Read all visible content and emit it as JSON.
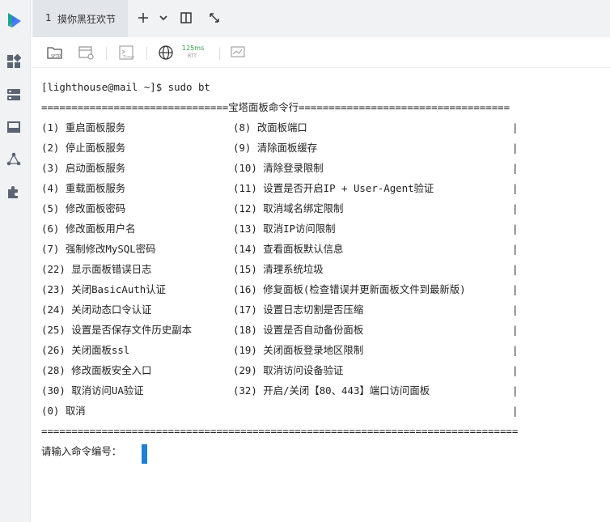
{
  "tab": {
    "number": "1",
    "title": "摸你黑狂欢节"
  },
  "toolbar": {
    "sftp_label": "SFTP",
    "timer_label": "Timer",
    "rtt_value": "125ms",
    "rtt_label": "RTT"
  },
  "terminal": {
    "prompt_line": "[lighthouse@mail ~]$ sudo bt",
    "header_line": "===============================宝塔面板命令行===================================",
    "rows": [
      {
        "left": "(1) 重启面板服务",
        "right": "(8) 改面板端口"
      },
      {
        "left": "(2) 停止面板服务",
        "right": "(9) 清除面板缓存"
      },
      {
        "left": "(3) 启动面板服务",
        "right": "(10) 清除登录限制"
      },
      {
        "left": "(4) 重载面板服务",
        "right": "(11) 设置是否开启IP + User-Agent验证"
      },
      {
        "left": "(5) 修改面板密码",
        "right": "(12) 取消域名绑定限制"
      },
      {
        "left": "(6) 修改面板用户名",
        "right": "(13) 取消IP访问限制"
      },
      {
        "left": "(7) 强制修改MySQL密码",
        "right": "(14) 查看面板默认信息"
      },
      {
        "left": "(22) 显示面板错误日志",
        "right": "(15) 清理系统垃圾"
      },
      {
        "left": "(23) 关闭BasicAuth认证",
        "right": "(16) 修复面板(检查错误并更新面板文件到最新版)"
      },
      {
        "left": "(24) 关闭动态口令认证",
        "right": "(17) 设置日志切割是否压缩"
      },
      {
        "left": "(25) 设置是否保存文件历史副本",
        "right": "(18) 设置是否自动备份面板"
      },
      {
        "left": "(26) 关闭面板ssl",
        "right": "(19) 关闭面板登录地区限制"
      },
      {
        "left": "(28) 修改面板安全入口",
        "right": "(29) 取消访问设备验证"
      },
      {
        "left": "(30) 取消访问UA验证",
        "right": "(32) 开启/关闭【80、443】端口访问面板"
      },
      {
        "left": "(0) 取消",
        "right": ""
      }
    ],
    "pipe": "|",
    "footer_line": "===============================================================================",
    "input_prompt": "请输入命令编号："
  },
  "colors": {
    "accent": "#1e7fd9",
    "rtt": "#2ea043",
    "sidebar_bg": "#f1f2f4"
  },
  "icons": {
    "sidebar": [
      "app-logo-icon",
      "dashboard-icon",
      "server-icon",
      "storage-icon",
      "network-icon",
      "plugin-icon"
    ],
    "tabbar": [
      "add-tab-icon",
      "chevron-down-icon",
      "split-view-icon",
      "fullscreen-icon"
    ],
    "toolbar": [
      "sftp-icon",
      "script-icon",
      "timer-icon",
      "globe-icon",
      "monitor-icon"
    ]
  }
}
